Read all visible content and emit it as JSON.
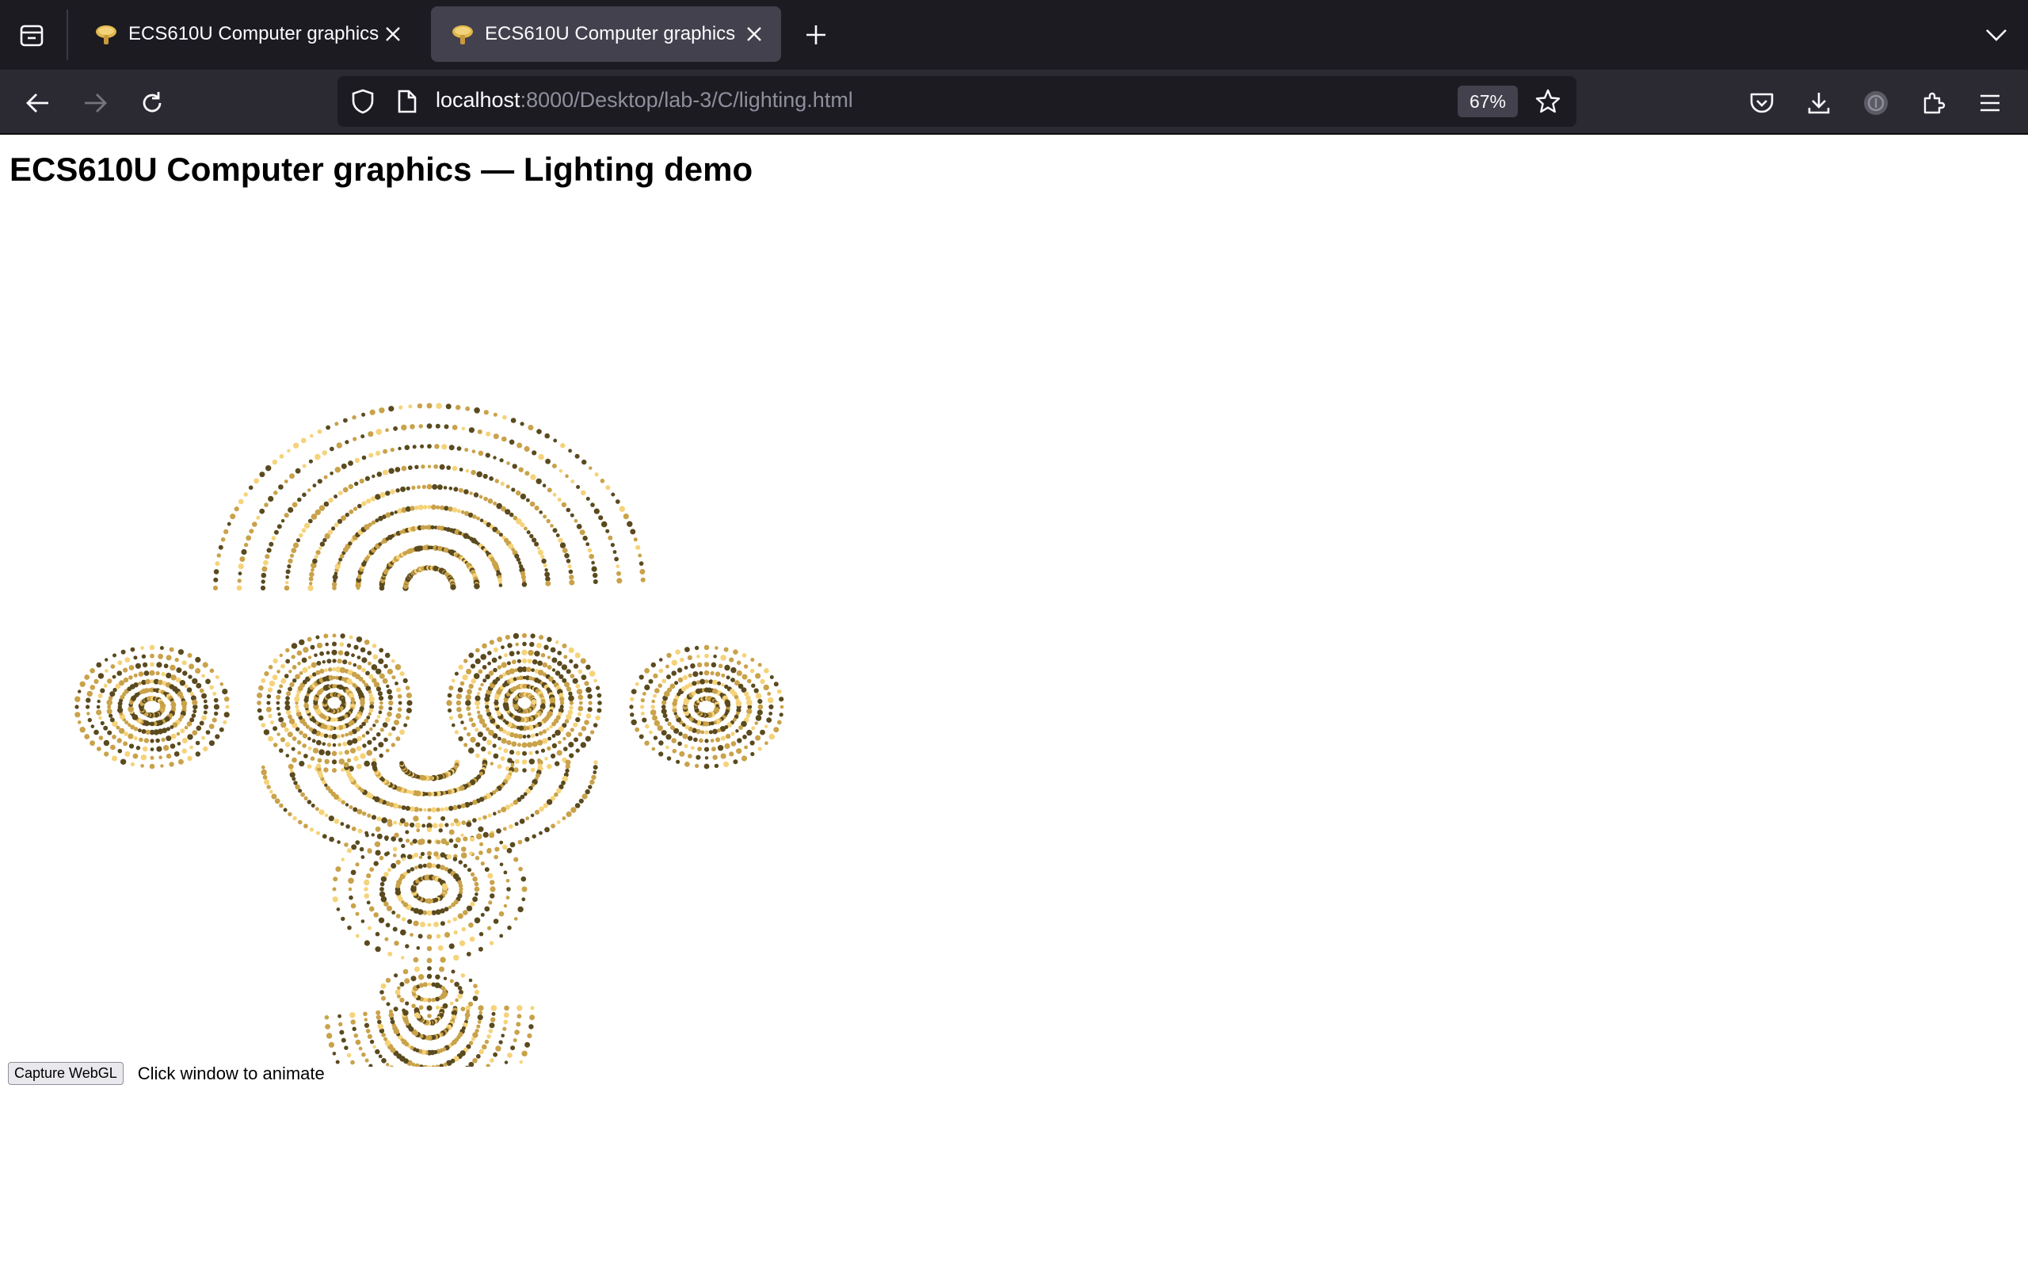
{
  "browser": {
    "tabs": [
      {
        "title": "ECS610U Computer graphics",
        "active": false,
        "favicon": "mushroom-icon"
      },
      {
        "title": "ECS610U Computer graphics",
        "active": true,
        "favicon": "mushroom-icon"
      }
    ],
    "url": {
      "host": "localhost",
      "rest": ":8000/Desktop/lab-3/C/lighting.html"
    },
    "zoom": "67%"
  },
  "page": {
    "title": "ECS610U Computer graphics — Lighting demo",
    "capture_button": "Capture WebGL",
    "hint": "Click window to animate"
  },
  "colors": {
    "chrome_dark": "#1c1b22",
    "toolbar": "#2b2a33",
    "active_tab": "#42414d",
    "point_light": "#f5d37a",
    "point_mid": "#c9a24a",
    "point_dark": "#5a4a1e"
  }
}
